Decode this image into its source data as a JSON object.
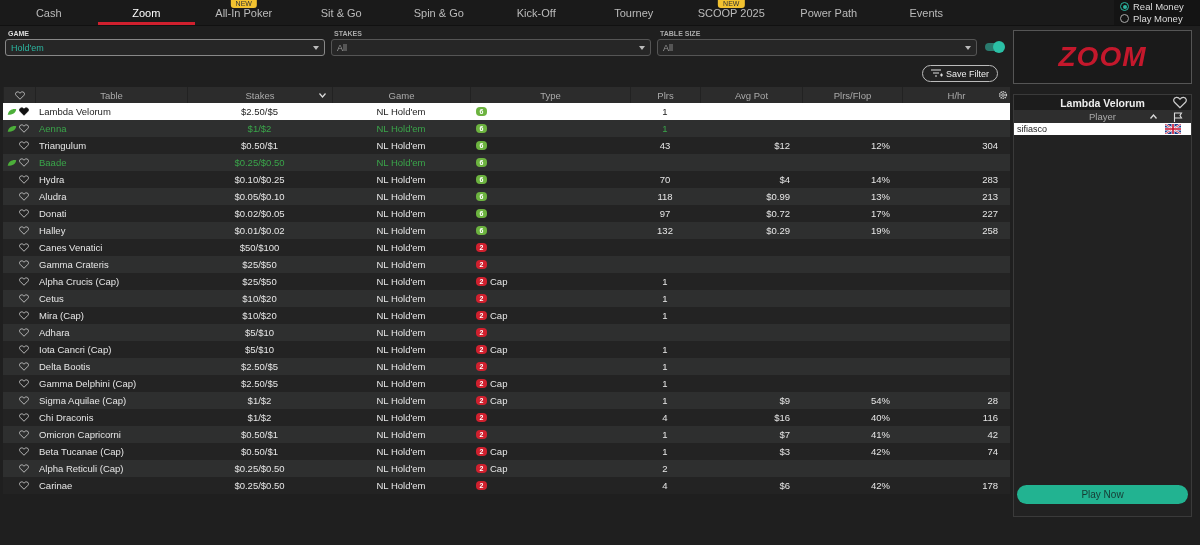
{
  "tabs": [
    {
      "label": "Cash",
      "selected": false
    },
    {
      "label": "Zoom",
      "selected": true
    },
    {
      "label": "All-In Poker",
      "selected": false,
      "badge": "NEW"
    },
    {
      "label": "Sit & Go",
      "selected": false
    },
    {
      "label": "Spin & Go",
      "selected": false
    },
    {
      "label": "Kick-Off",
      "selected": false
    },
    {
      "label": "Tourney",
      "selected": false
    },
    {
      "label": "SCOOP 2025",
      "selected": false,
      "badge": "NEW"
    },
    {
      "label": "Power Path",
      "selected": false
    },
    {
      "label": "Events",
      "selected": false
    }
  ],
  "money_mode": [
    {
      "label": "Real Money",
      "selected": true
    },
    {
      "label": "Play Money",
      "selected": false
    }
  ],
  "filters": [
    {
      "label": "GAME",
      "value": "Hold'em",
      "highlight": true
    },
    {
      "label": "STAKES",
      "value": "All",
      "highlight": false
    },
    {
      "label": "TABLE SIZE",
      "value": "All",
      "highlight": false
    }
  ],
  "filter_toggle": {
    "on": true
  },
  "save_filter": "Save Filter",
  "logo": "ZOOM",
  "table": {
    "columns": [
      "Table",
      "Stakes",
      "Game",
      "Type",
      "Plrs",
      "Avg Pot",
      "Plrs/Flop",
      "H/hr"
    ],
    "rows": [
      {
        "name": "Lambda Velorum",
        "stakes": "$2.50/$5",
        "game": "NL Hold'em",
        "badge": "6",
        "color": "#6cb33f",
        "plrs": "1",
        "selected": true,
        "seated": true,
        "favorite": true
      },
      {
        "name": "Aenna",
        "stakes": "$1/$2",
        "game": "NL Hold'em",
        "badge": "6",
        "color": "#6cb33f",
        "plrs": "1",
        "selected": false,
        "seated": true,
        "favorite": false
      },
      {
        "name": "Triangulum",
        "stakes": "$0.50/$1",
        "game": "NL Hold'em",
        "badge": "6",
        "color": "#6cb33f",
        "plrs": "43",
        "avg_pot": "$12",
        "plrs_flop": "12%",
        "h_hr": "304",
        "selected": false,
        "seated": false,
        "favorite": false
      },
      {
        "name": "Baade",
        "stakes": "$0.25/$0.50",
        "game": "NL Hold'em",
        "badge": "6",
        "color": "#6cb33f",
        "selected": false,
        "seated": true,
        "favorite": false
      },
      {
        "name": "Hydra",
        "stakes": "$0.10/$0.25",
        "game": "NL Hold'em",
        "badge": "6",
        "color": "#6cb33f",
        "plrs": "70",
        "avg_pot": "$4",
        "plrs_flop": "14%",
        "h_hr": "283",
        "selected": false,
        "seated": false,
        "favorite": false
      },
      {
        "name": "Aludra",
        "stakes": "$0.05/$0.10",
        "game": "NL Hold'em",
        "badge": "6",
        "color": "#6cb33f",
        "plrs": "118",
        "avg_pot": "$0.99",
        "plrs_flop": "13%",
        "h_hr": "213",
        "selected": false,
        "seated": false,
        "favorite": false
      },
      {
        "name": "Donati",
        "stakes": "$0.02/$0.05",
        "game": "NL Hold'em",
        "badge": "6",
        "color": "#6cb33f",
        "plrs": "97",
        "avg_pot": "$0.72",
        "plrs_flop": "17%",
        "h_hr": "227",
        "selected": false,
        "seated": false,
        "favorite": false
      },
      {
        "name": "Halley",
        "stakes": "$0.01/$0.02",
        "game": "NL Hold'em",
        "badge": "6",
        "color": "#6cb33f",
        "plrs": "132",
        "avg_pot": "$0.29",
        "plrs_flop": "19%",
        "h_hr": "258",
        "selected": false,
        "seated": false,
        "favorite": false
      },
      {
        "name": "Canes Venatici",
        "stakes": "$50/$100",
        "game": "NL Hold'em",
        "badge": "2",
        "color": "#d0202e",
        "selected": false,
        "seated": false,
        "favorite": false
      },
      {
        "name": "Gamma Crateris",
        "stakes": "$25/$50",
        "game": "NL Hold'em",
        "badge": "2",
        "color": "#d0202e",
        "selected": false,
        "seated": false,
        "favorite": false
      },
      {
        "name": "Alpha Crucis (Cap)",
        "stakes": "$25/$50",
        "game": "NL Hold'em",
        "badge": "2",
        "color": "#d0202e",
        "type_label": "Cap",
        "plrs": "1",
        "selected": false,
        "seated": false,
        "favorite": false
      },
      {
        "name": "Cetus",
        "stakes": "$10/$20",
        "game": "NL Hold'em",
        "badge": "2",
        "color": "#d0202e",
        "plrs": "1",
        "selected": false,
        "seated": false,
        "favorite": false
      },
      {
        "name": "Mira (Cap)",
        "stakes": "$10/$20",
        "game": "NL Hold'em",
        "badge": "2",
        "color": "#d0202e",
        "type_label": "Cap",
        "plrs": "1",
        "selected": false,
        "seated": false,
        "favorite": false
      },
      {
        "name": "Adhara",
        "stakes": "$5/$10",
        "game": "NL Hold'em",
        "badge": "2",
        "color": "#d0202e",
        "selected": false,
        "seated": false,
        "favorite": false
      },
      {
        "name": "Iota Cancri (Cap)",
        "stakes": "$5/$10",
        "game": "NL Hold'em",
        "badge": "2",
        "color": "#d0202e",
        "type_label": "Cap",
        "plrs": "1",
        "selected": false,
        "seated": false,
        "favorite": false
      },
      {
        "name": "Delta Bootis",
        "stakes": "$2.50/$5",
        "game": "NL Hold'em",
        "badge": "2",
        "color": "#d0202e",
        "plrs": "1",
        "selected": false,
        "seated": false,
        "favorite": false
      },
      {
        "name": "Gamma Delphini (Cap)",
        "stakes": "$2.50/$5",
        "game": "NL Hold'em",
        "badge": "2",
        "color": "#d0202e",
        "type_label": "Cap",
        "plrs": "1",
        "selected": false,
        "seated": false,
        "favorite": false
      },
      {
        "name": "Sigma Aquilae (Cap)",
        "stakes": "$1/$2",
        "game": "NL Hold'em",
        "badge": "2",
        "color": "#d0202e",
        "type_label": "Cap",
        "plrs": "1",
        "avg_pot": "$9",
        "plrs_flop": "54%",
        "h_hr": "28",
        "selected": false,
        "seated": false,
        "favorite": false
      },
      {
        "name": "Chi Draconis",
        "stakes": "$1/$2",
        "game": "NL Hold'em",
        "badge": "2",
        "color": "#d0202e",
        "plrs": "4",
        "avg_pot": "$16",
        "plrs_flop": "40%",
        "h_hr": "116",
        "selected": false,
        "seated": false,
        "favorite": false
      },
      {
        "name": "Omicron Capricorni",
        "stakes": "$0.50/$1",
        "game": "NL Hold'em",
        "badge": "2",
        "color": "#d0202e",
        "plrs": "1",
        "avg_pot": "$7",
        "plrs_flop": "41%",
        "h_hr": "42",
        "selected": false,
        "seated": false,
        "favorite": false
      },
      {
        "name": "Beta Tucanae (Cap)",
        "stakes": "$0.50/$1",
        "game": "NL Hold'em",
        "badge": "2",
        "color": "#d0202e",
        "type_label": "Cap",
        "plrs": "1",
        "avg_pot": "$3",
        "plrs_flop": "42%",
        "h_hr": "74",
        "selected": false,
        "seated": false,
        "favorite": false
      },
      {
        "name": "Alpha Reticuli (Cap)",
        "stakes": "$0.25/$0.50",
        "game": "NL Hold'em",
        "badge": "2",
        "color": "#d0202e",
        "type_label": "Cap",
        "plrs": "2",
        "selected": false,
        "seated": false,
        "favorite": false
      },
      {
        "name": "Carinae",
        "stakes": "$0.25/$0.50",
        "game": "NL Hold'em",
        "badge": "2",
        "color": "#d0202e",
        "plrs": "4",
        "avg_pot": "$6",
        "plrs_flop": "42%",
        "h_hr": "178",
        "selected": false,
        "seated": false,
        "favorite": false
      }
    ]
  },
  "side_panel": {
    "title": "Lambda Velorum",
    "column": "Player",
    "players": [
      {
        "name": "sifiasco"
      }
    ],
    "play_button": "Play Now"
  }
}
